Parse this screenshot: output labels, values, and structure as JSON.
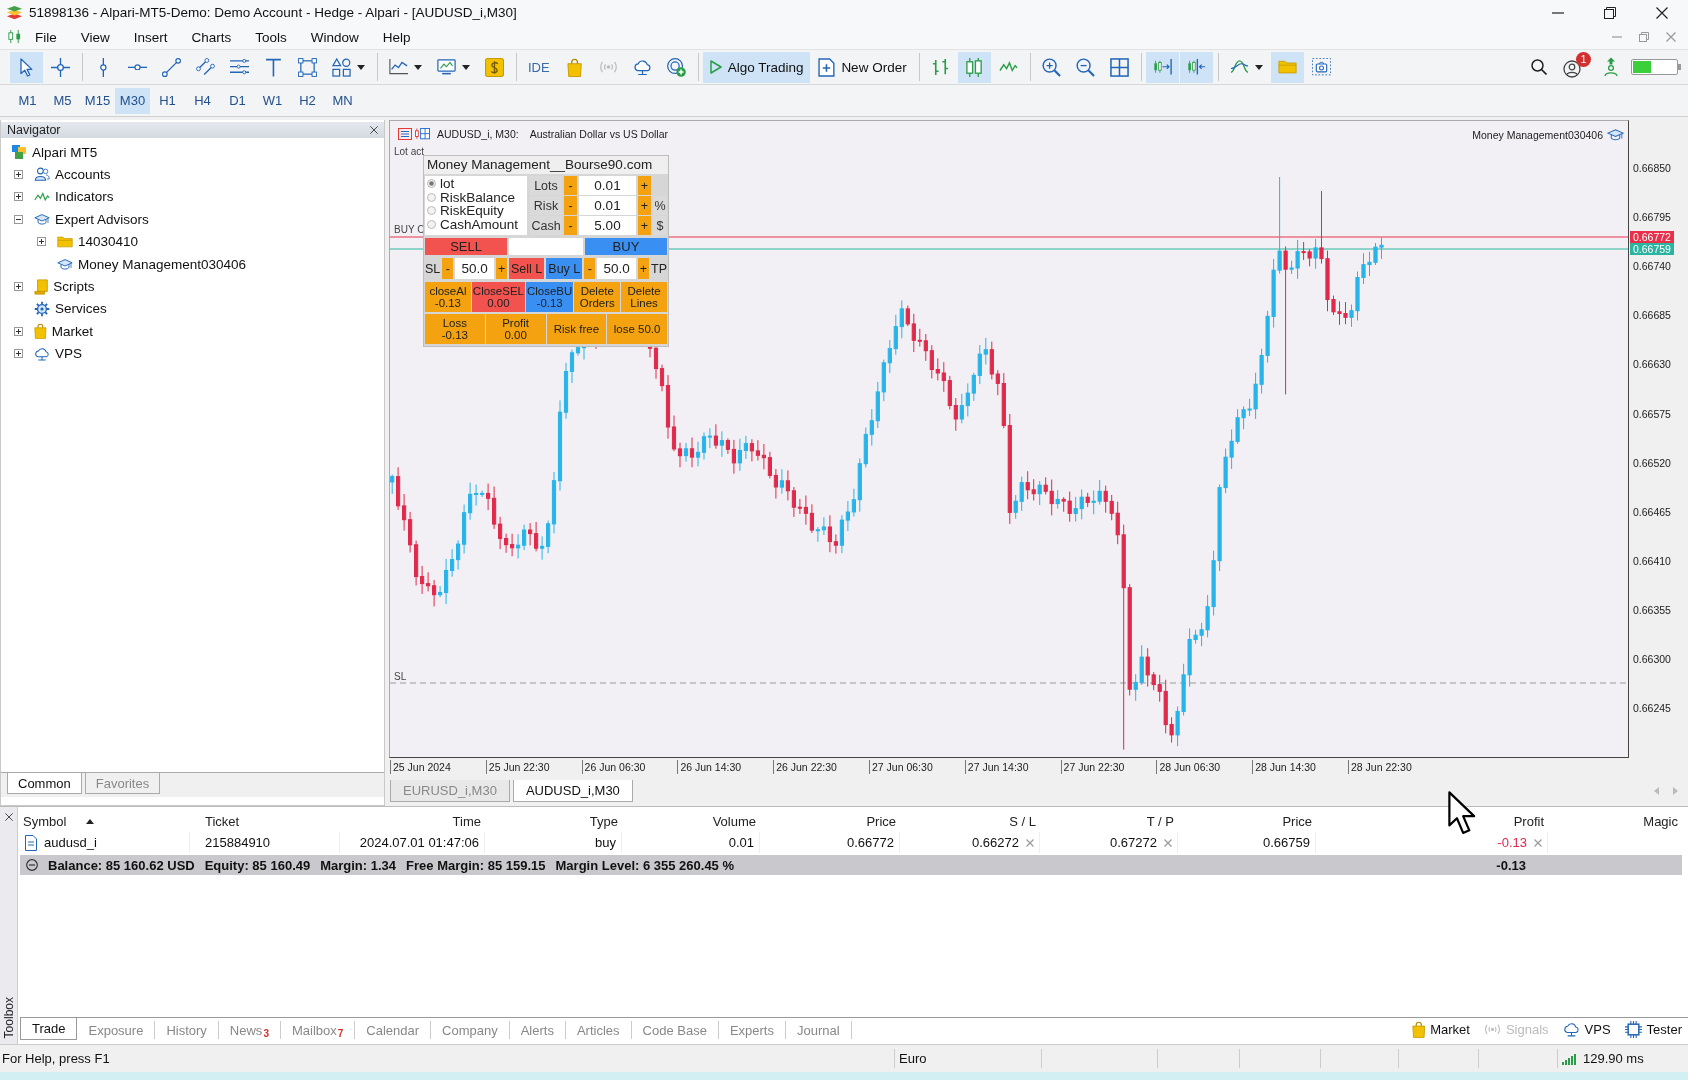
{
  "window": {
    "title": "51898136 - Alpari-MT5-Demo: Demo Account - Hedge - Alpari - [AUDUSD_i,M30]"
  },
  "menu": [
    "File",
    "View",
    "Insert",
    "Charts",
    "Tools",
    "Window",
    "Help"
  ],
  "toolbar": {
    "items": [
      {
        "selected": true
      },
      {
        "selected": false
      },
      {
        "selected": false
      },
      {
        "selected": false
      },
      {
        "selected": false
      },
      {
        "selected": false
      },
      {
        "selected": false
      },
      {
        "selected": false
      },
      {
        "selected": false
      },
      {
        "selected": false
      },
      {
        "selected": false
      },
      {
        "selected": false
      },
      {
        "selected": false
      },
      {
        "label": "IDE",
        "selected": false
      },
      {
        "selected": false
      },
      {
        "selected": false
      },
      {
        "selected": false
      },
      {
        "selected": false
      },
      {
        "label": "Algo Trading",
        "selected": true
      },
      {
        "label": "New Order",
        "selected": false
      },
      {
        "selected": false
      },
      {
        "selected": true
      },
      {
        "selected": false
      },
      {
        "selected": false
      },
      {
        "selected": false
      },
      {
        "selected": false
      },
      {
        "selected": true
      },
      {
        "selected": true
      },
      {
        "selected": false
      },
      {
        "selected": true
      },
      {
        "selected": false
      }
    ],
    "notifications": "1"
  },
  "timeframes": [
    {
      "label": "M1",
      "selected": false
    },
    {
      "label": "M5",
      "selected": false
    },
    {
      "label": "M15",
      "selected": false
    },
    {
      "label": "M30",
      "selected": true
    },
    {
      "label": "H1",
      "selected": false
    },
    {
      "label": "H4",
      "selected": false
    },
    {
      "label": "D1",
      "selected": false
    },
    {
      "label": "W1",
      "selected": false
    },
    {
      "label": "H2",
      "selected": false
    },
    {
      "label": "MN",
      "selected": false
    }
  ],
  "navigator": {
    "title": "Navigator",
    "tree": [
      {
        "label": "Alpari MT5",
        "children": [
          {
            "label": "Accounts",
            "expanded": false
          },
          {
            "label": "Indicators",
            "expanded": false
          },
          {
            "label": "Expert Advisors",
            "expanded": true,
            "children": [
              {
                "label": "14030410",
                "expanded": false
              },
              {
                "label": "Money Management030406"
              }
            ]
          },
          {
            "label": "Scripts",
            "expanded": false
          },
          {
            "label": "Services"
          },
          {
            "label": "Market",
            "expanded": false
          },
          {
            "label": "VPS",
            "expanded": false
          }
        ]
      }
    ],
    "tabs": [
      {
        "label": "Common",
        "selected": true
      },
      {
        "label": "Favorites",
        "selected": false
      }
    ]
  },
  "chart": {
    "symbol": "AUDUSD_i, M30:",
    "description": "Australian Dollar vs US Dollar",
    "expert": "Money Management030406",
    "lot_label": "Lot act",
    "buy_label": "BUY C",
    "sl_label": "SL",
    "price_axis": [
      "0.66850",
      "0.66795",
      "0.66740",
      "0.66685",
      "0.66630",
      "0.66575",
      "0.66520",
      "0.66465",
      "0.66410",
      "0.66355",
      "0.66300",
      "0.66245"
    ],
    "price_markers": [
      {
        "text": "0.66772",
        "color": "#e8304a"
      },
      {
        "text": "0.66759",
        "color": "#2bb5a0"
      }
    ],
    "time_axis": [
      "25 Jun 2024",
      "25 Jun 22:30",
      "26 Jun 06:30",
      "26 Jun 14:30",
      "26 Jun 22:30",
      "27 Jun 06:30",
      "27 Jun 14:30",
      "27 Jun 22:30",
      "28 Jun 06:30",
      "28 Jun 14:30",
      "28 Jun 22:30"
    ]
  },
  "ea_panel": {
    "title": "Money Management__Bourse90.com",
    "modes": [
      {
        "label": "lot",
        "selected": true
      },
      {
        "label": "RiskBalance",
        "selected": false
      },
      {
        "label": "RiskEquity",
        "selected": false
      },
      {
        "label": "CashAmount",
        "selected": false
      }
    ],
    "inputs": [
      {
        "label": "Lots",
        "minus": "-",
        "value": "0.01",
        "plus": "+"
      },
      {
        "label": "Risk",
        "minus": "-",
        "value": "0.01",
        "plus": "+",
        "unit": "%"
      },
      {
        "label": "Cash",
        "minus": "-",
        "value": "5.00",
        "plus": "+",
        "unit": "$"
      }
    ],
    "sell": "SELL",
    "buy": "BUY",
    "stops": [
      {
        "label": "SL",
        "minus": "-",
        "value": "50.0",
        "plus": "+"
      },
      {
        "label": "TP",
        "minus": "-",
        "value": "50.0",
        "plus": "+"
      }
    ],
    "sell_limit": "Sell L",
    "buy_limit": "Buy L",
    "close_buttons": [
      {
        "label": "closeAl",
        "value": "-0.13",
        "color": "#f4a20f"
      },
      {
        "label": "CloseSEL",
        "value": "0.00",
        "color": "#f2534e"
      },
      {
        "label": "CloseBU",
        "value": "-0.13",
        "color": "#3a8ff2"
      },
      {
        "label": "Delete Orders",
        "color": "#f4a20f"
      },
      {
        "label": "Delete Lines",
        "color": "#f4a20f"
      }
    ],
    "bottom_buttons": [
      {
        "label": "Loss",
        "value": "-0.13"
      },
      {
        "label": "Profit",
        "value": "0.00"
      },
      {
        "label": "Risk free"
      },
      {
        "label": "lose 50.0"
      }
    ]
  },
  "chart_tabs": [
    {
      "label": "EURUSD_i,M30",
      "selected": false
    },
    {
      "label": "AUDUSD_i,M30",
      "selected": true
    }
  ],
  "toolbox": {
    "title": "Toolbox",
    "columns": [
      {
        "label": "Symbol",
        "sorted": true
      },
      {
        "label": "Ticket",
        "sorted": false
      },
      {
        "label": "Time",
        "sorted": false
      },
      {
        "label": "Type",
        "sorted": false
      },
      {
        "label": "Volume",
        "sorted": false
      },
      {
        "label": "Price",
        "sorted": false
      },
      {
        "label": "S / L",
        "sorted": false
      },
      {
        "label": "T / P",
        "sorted": false
      },
      {
        "label": "Price",
        "sorted": false
      },
      {
        "label": "Profit",
        "sorted": false
      },
      {
        "label": "Magic",
        "sorted": false
      }
    ],
    "rows": [
      {
        "symbol": "audusd_i",
        "ticket": "215884910",
        "time": "2024.07.01 01:47:06",
        "type": "buy",
        "volume": "0.01",
        "open_price": "0.66772",
        "sl": "0.66272",
        "tp": "0.67272",
        "price": "0.66759",
        "profit": "-0.13",
        "loss": true
      }
    ],
    "summary": {
      "items": [
        "Balance: 85 160.62 USD",
        "Equity: 85 160.49",
        "Margin: 1.34",
        "Free Margin: 85 159.15",
        "Margin Level: 6 355 260.45 %"
      ],
      "profit": "-0.13"
    },
    "tabs": [
      {
        "label": "Trade",
        "selected": true
      },
      {
        "label": "Exposure",
        "selected": false
      },
      {
        "label": "History",
        "selected": false
      },
      {
        "label": "News",
        "badge": "3",
        "selected": false
      },
      {
        "label": "Mailbox",
        "badge": "7",
        "selected": false
      },
      {
        "label": "Calendar",
        "selected": false
      },
      {
        "label": "Company",
        "selected": false
      },
      {
        "label": "Alerts",
        "selected": false
      },
      {
        "label": "Articles",
        "selected": false
      },
      {
        "label": "Code Base",
        "selected": false
      },
      {
        "label": "Experts",
        "selected": false
      },
      {
        "label": "Journal",
        "selected": false
      }
    ],
    "links": [
      {
        "label": "Market",
        "disabled": false
      },
      {
        "label": "Signals",
        "disabled": true
      },
      {
        "label": "VPS",
        "disabled": false
      },
      {
        "label": "Tester",
        "disabled": false
      }
    ]
  },
  "status_bar": {
    "help": "For Help, press F1",
    "profile": "Euro",
    "ping": "129.90 ms"
  }
}
